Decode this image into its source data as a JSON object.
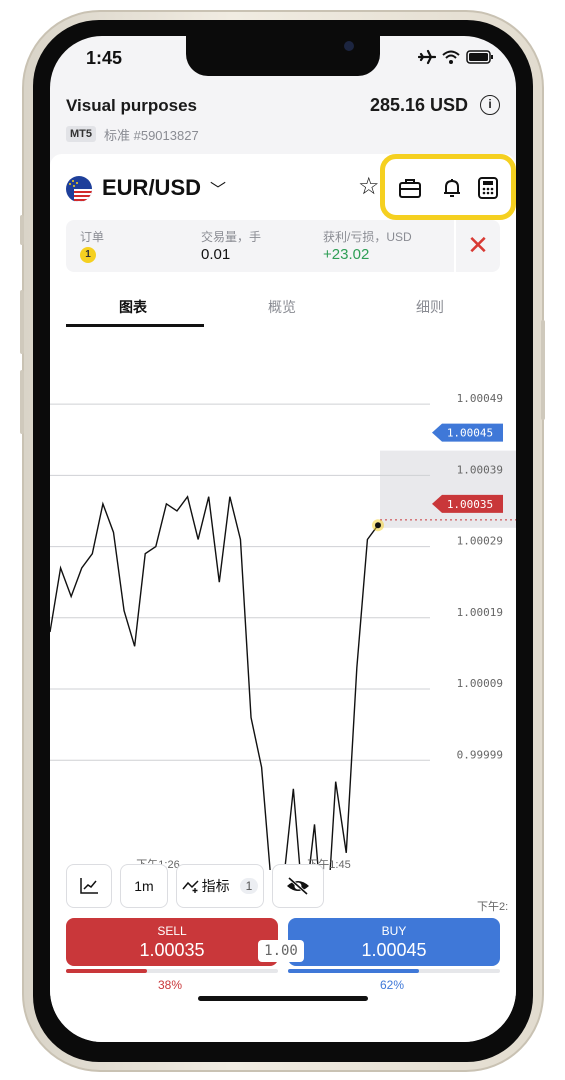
{
  "status_bar": {
    "time": "1:45"
  },
  "account": {
    "name": "Visual purposes",
    "balance": "285.16 USD",
    "platform_badge": "MT5",
    "id_text": "标准 #59013827"
  },
  "symbol": {
    "name": "EUR/USD"
  },
  "order_card": {
    "orders_label": "订单",
    "orders_count": "1",
    "volume_label": "交易量，手",
    "volume_value": "0.01",
    "pnl_label": "获利/亏损，USD",
    "pnl_value": "+23.02"
  },
  "tabs": [
    "图表",
    "概览",
    "细则"
  ],
  "chart_data": {
    "type": "line",
    "y_tick_labels": [
      "1.00049",
      "1.00039",
      "1.00029",
      "1.00019",
      "1.00009",
      "0.99999"
    ],
    "y_ticks": [
      1.00049,
      1.00039,
      1.00029,
      1.00019,
      1.00009,
      0.99999
    ],
    "ylim": [
      0.99985,
      1.00058
    ],
    "x_labels": [
      "下午1:26",
      "下午1:45"
    ],
    "buy_marker": "1.00045",
    "sell_marker": "1.00035",
    "series": [
      {
        "values": [
          1.00017,
          1.00026,
          1.00022,
          1.00026,
          1.00028,
          1.00035,
          1.00031,
          1.0002,
          1.00015,
          1.00028,
          1.00029,
          1.00035,
          1.00034,
          1.00036,
          1.0003,
          1.00036,
          1.00024,
          1.00036,
          1.0003,
          1.00005,
          0.99998,
          0.9998,
          0.99981,
          0.99995,
          0.99977,
          0.9999,
          0.99972,
          0.99996,
          0.99986,
          1.00012,
          1.0003,
          1.00032
        ]
      }
    ]
  },
  "toolbar": {
    "timeframe": "1m",
    "indicators_label": "指标",
    "indicators_count": "1",
    "x_label_right": "下午2:"
  },
  "trade": {
    "sell_label": "SELL",
    "sell_price": "1.00035",
    "buy_label": "BUY",
    "buy_price": "1.00045",
    "spread": "1.00",
    "sell_pct": "38%",
    "buy_pct": "62%",
    "sell_fraction": 0.38,
    "buy_fraction": 0.62
  },
  "colors": {
    "sell": "#c9373a",
    "buy": "#3f78d8",
    "profit": "#2e9e55",
    "highlight": "#f5d020"
  }
}
